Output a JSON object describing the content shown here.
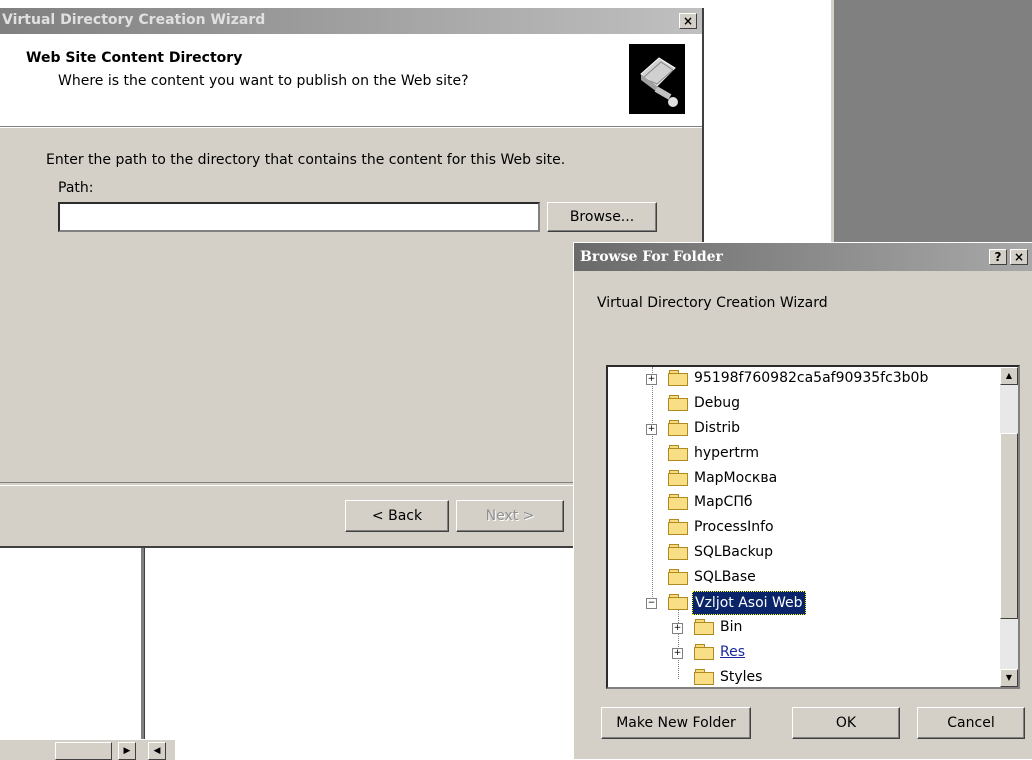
{
  "wizard": {
    "title": "Virtual Directory Creation Wizard",
    "close_glyph": "×",
    "header_title": "Web Site Content Directory",
    "header_subtitle": "Where is the content you want to publish on the Web site?",
    "instruction": "Enter the path to the directory that contains the content for this Web site.",
    "path_label": "Path:",
    "path_value": "",
    "browse_label": "Browse...",
    "back_label": "< Back",
    "next_label": "Next >"
  },
  "browse_dialog": {
    "title": "Browse For Folder",
    "help_glyph": "?",
    "close_glyph": "×",
    "description": "Virtual Directory Creation Wizard",
    "folders": [
      {
        "label": "95198f760982ca5af90935fc3b0b",
        "expander": "+"
      },
      {
        "label": "Debug",
        "expander": ""
      },
      {
        "label": "Distrib",
        "expander": "+"
      },
      {
        "label": "hypertrm",
        "expander": ""
      },
      {
        "label": "МарМосква",
        "expander": ""
      },
      {
        "label": "МарСПб",
        "expander": ""
      },
      {
        "label": "ProcessInfo",
        "expander": ""
      },
      {
        "label": "SQLBackup",
        "expander": ""
      },
      {
        "label": "SQLBase",
        "expander": ""
      },
      {
        "label": "Vzljot Asoi Web",
        "expander": "−",
        "selected": true
      },
      {
        "label": "Bin",
        "expander": "+"
      },
      {
        "label": "Res",
        "expander": "+"
      },
      {
        "label": "Styles",
        "expander": ""
      }
    ],
    "make_new_folder_label": "Make New Folder",
    "ok_label": "OK",
    "cancel_label": "Cancel"
  },
  "colors": {
    "dialog_face": "#d4d0c8",
    "selection": "#0a246a",
    "folder_yellow": "#f8df85"
  }
}
